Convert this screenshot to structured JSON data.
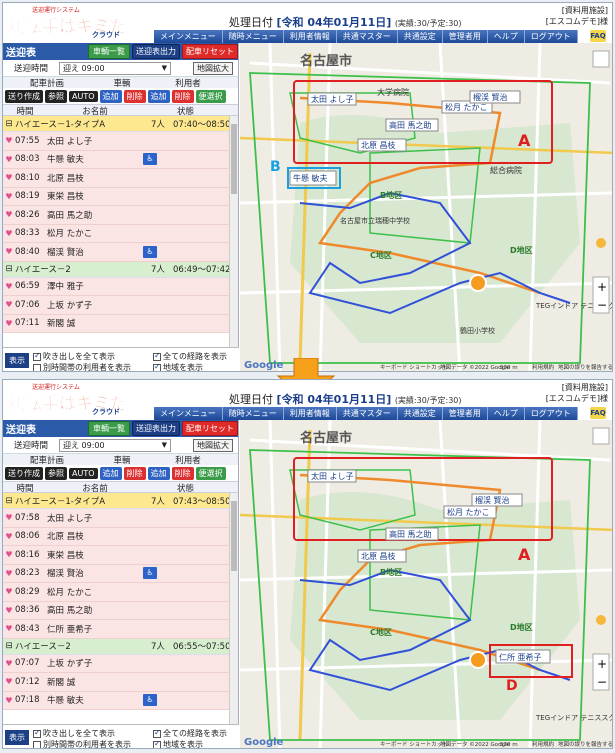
{
  "app": {
    "logo_top": "送迎運行システム",
    "logo_main": "運転手はキミだ!!",
    "logo_sub": "クラウド",
    "proc_label": "処理日付",
    "proc_date": "[令和 04年01月11日]",
    "facility_line1": "[資料用施設]",
    "facility_line2": "[エスコムデモ]様",
    "faq": "FAQ",
    "menu": [
      "メインメニュー",
      "随時メニュー",
      "利用者情報",
      "共通マスター",
      "共通設定",
      "管理者用",
      "ヘルプ",
      "ログアウト"
    ]
  },
  "left": {
    "title": "送迎表",
    "btn_vehicle_list": "車輌一覧",
    "btn_output": "送迎表出力",
    "btn_reset": "配車リセット",
    "time_label": "送迎時間",
    "time_value": "迎え 09:00",
    "map_zoom": "地図拡大",
    "hdr_dispatch": "配車計画",
    "hdr_vehicle": "車輌",
    "hdr_user": "利用者",
    "btn_create": "送り作成",
    "btn_ref": "参照",
    "btn_auto": "AUTO",
    "btn_add": "追加",
    "btn_del": "削除",
    "btn_select": "便選択",
    "col_time": "時間",
    "col_name": "お名前",
    "col_status": "状態",
    "footer_disp": "表示",
    "opt_balloon": "吹き出しを全て表示",
    "opt_other": "別時間帯の利用者を表示",
    "opt_route": "全ての経路を表示",
    "opt_area": "地域を表示"
  },
  "panel1": {
    "status_line": "(実績:30/予定:30)",
    "vehicles": [
      {
        "name": "ハイエース－1-タイプA",
        "count": "7人",
        "time": "07:40～08:50",
        "color": "y",
        "rows": [
          {
            "time": "07:55",
            "name": "太田 よし子",
            "ac": false
          },
          {
            "time": "08:03",
            "name": "牛懸 敏夫",
            "ac": true
          },
          {
            "time": "08:10",
            "name": "北原 昌枝",
            "ac": false
          },
          {
            "time": "08:19",
            "name": "東栄 昌枝",
            "ac": false
          },
          {
            "time": "08:26",
            "name": "高田 馬之助",
            "ac": false
          },
          {
            "time": "08:33",
            "name": "松月 たかこ",
            "ac": false
          },
          {
            "time": "08:40",
            "name": "榴渓 賢治",
            "ac": true
          }
        ]
      },
      {
        "name": "ハイエース－2",
        "count": "7人",
        "time": "06:49～07:42",
        "color": "g",
        "rows": [
          {
            "time": "06:59",
            "name": "澤中 雅子",
            "ac": false
          },
          {
            "time": "07:06",
            "name": "上坂 かず子",
            "ac": false
          },
          {
            "time": "07:11",
            "name": "新閣 誠",
            "ac": false
          }
        ]
      }
    ],
    "map_labels": [
      "名古屋市",
      "大学病院",
      "総合病院",
      "B地区",
      "C地区",
      "D地区",
      "A",
      "B",
      "TEGインドア テニススクール",
      "名古屋市立瑞穂中学校",
      "鶴田小学校",
      "Google",
      "キーボード ショートカット",
      "地図データ ©2022 Google",
      "500 m",
      "利用規約",
      "地図の誤りを報告する"
    ],
    "map_balloons": [
      "太田 よし子",
      "北原 昌枝",
      "高田 馬之助",
      "松月 たかこ",
      "榴渓 賢治",
      "牛懸 敏夫"
    ]
  },
  "panel2": {
    "status_line": "(実績:30/予定:30)",
    "vehicles": [
      {
        "name": "ハイエース－1-タイプA",
        "count": "7人",
        "time": "07:43～08:50",
        "color": "y",
        "rows": [
          {
            "time": "07:58",
            "name": "太田 よし子",
            "ac": false
          },
          {
            "time": "08:06",
            "name": "北原 昌枝",
            "ac": false
          },
          {
            "time": "08:16",
            "name": "東栄 昌枝",
            "ac": false
          },
          {
            "time": "08:23",
            "name": "榴渓 賢治",
            "ac": true
          },
          {
            "time": "08:29",
            "name": "松月 たかこ",
            "ac": false
          },
          {
            "time": "08:36",
            "name": "高田 馬之助",
            "ac": false
          },
          {
            "time": "08:43",
            "name": "仁所 亜希子",
            "ac": false
          }
        ]
      },
      {
        "name": "ハイエース－2",
        "count": "7人",
        "time": "06:55～07:50",
        "color": "g",
        "rows": [
          {
            "time": "07:07",
            "name": "上坂 かず子",
            "ac": false
          },
          {
            "time": "07:12",
            "name": "新閣 誠",
            "ac": false
          },
          {
            "time": "07:18",
            "name": "牛懸 敏夫",
            "ac": true
          }
        ]
      }
    ],
    "map_labels": [
      "名古屋市",
      "A",
      "D"
    ],
    "map_balloons": [
      "太田 よし子",
      "松月 たかこ",
      "榴渓 賢治",
      "高田 馬之助",
      "北原 昌枝",
      "仁所 亜希子"
    ]
  },
  "colors": {
    "accent": "#2a5aa8",
    "route_orange": "#ef8a2c",
    "route_blue": "#3050d8",
    "box_red": "#e02020",
    "box_cyan": "#1aa0e0"
  }
}
